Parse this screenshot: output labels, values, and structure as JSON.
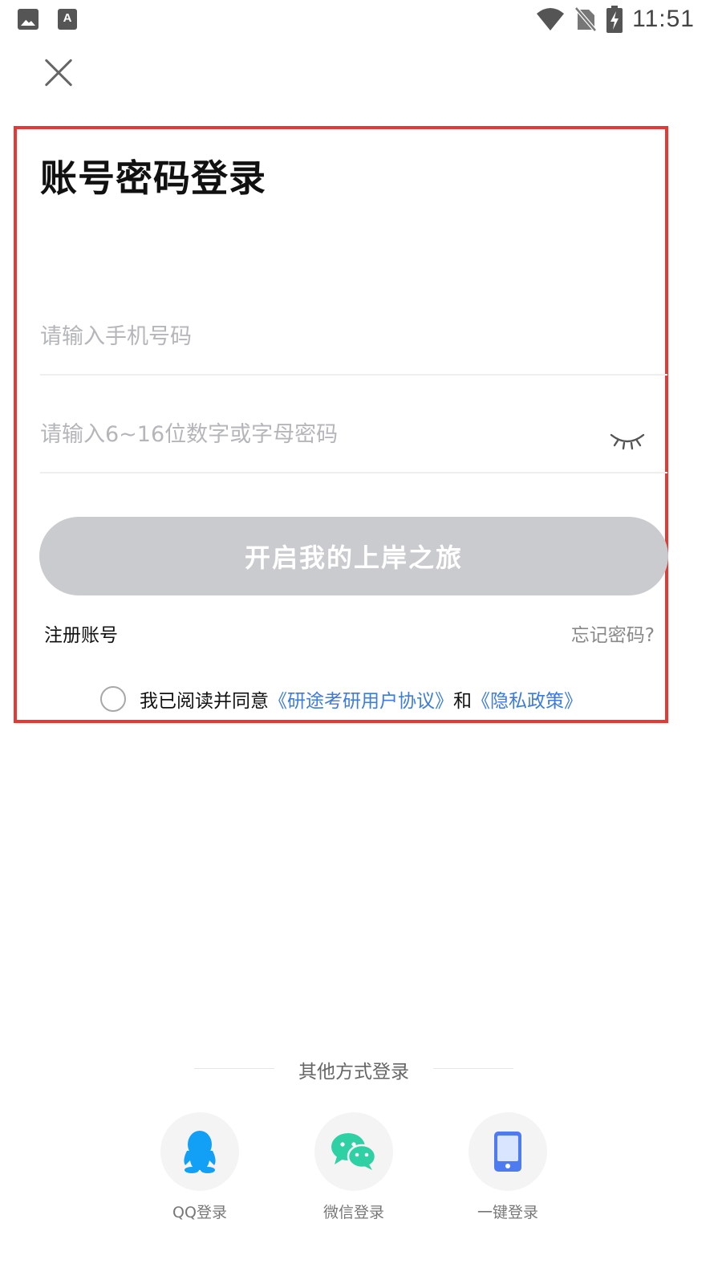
{
  "status_bar": {
    "time": "11:51",
    "left_icons": [
      "image-icon",
      "a-keyboard-icon"
    ],
    "right_icons": [
      "wifi-icon",
      "no-sim-icon",
      "battery-charging-icon"
    ],
    "a_icon_glyph": "A"
  },
  "header": {
    "close_icon": "close-icon"
  },
  "login": {
    "title": "账号密码登录",
    "phone_placeholder": "请输入手机号码",
    "password_placeholder": "请输入6~16位数字或字母密码",
    "password_toggle_icon": "eye-closed-icon",
    "submit_label": "开启我的上岸之旅",
    "register_label": "注册账号",
    "forgot_label": "忘记密码?",
    "agreement": {
      "prefix": "我已阅读并同意",
      "user_agreement": "《研途考研用户协议》",
      "conjunction": "和",
      "privacy_policy": "《隐私政策》",
      "checked": false
    }
  },
  "other_login": {
    "title": "其他方式登录",
    "options": [
      {
        "label": "QQ登录",
        "icon": "qq-penguin-icon",
        "color": "#12a0f7"
      },
      {
        "label": "微信登录",
        "icon": "wechat-icon",
        "color": "#2ed0a4"
      },
      {
        "label": "一键登录",
        "icon": "phone-icon",
        "color": "#4f7bf0"
      }
    ]
  },
  "colors": {
    "highlight_border": "#e53935",
    "link": "#3d7bde",
    "button_disabled": "#c9cbcf",
    "placeholder": "#b4b6ba"
  }
}
